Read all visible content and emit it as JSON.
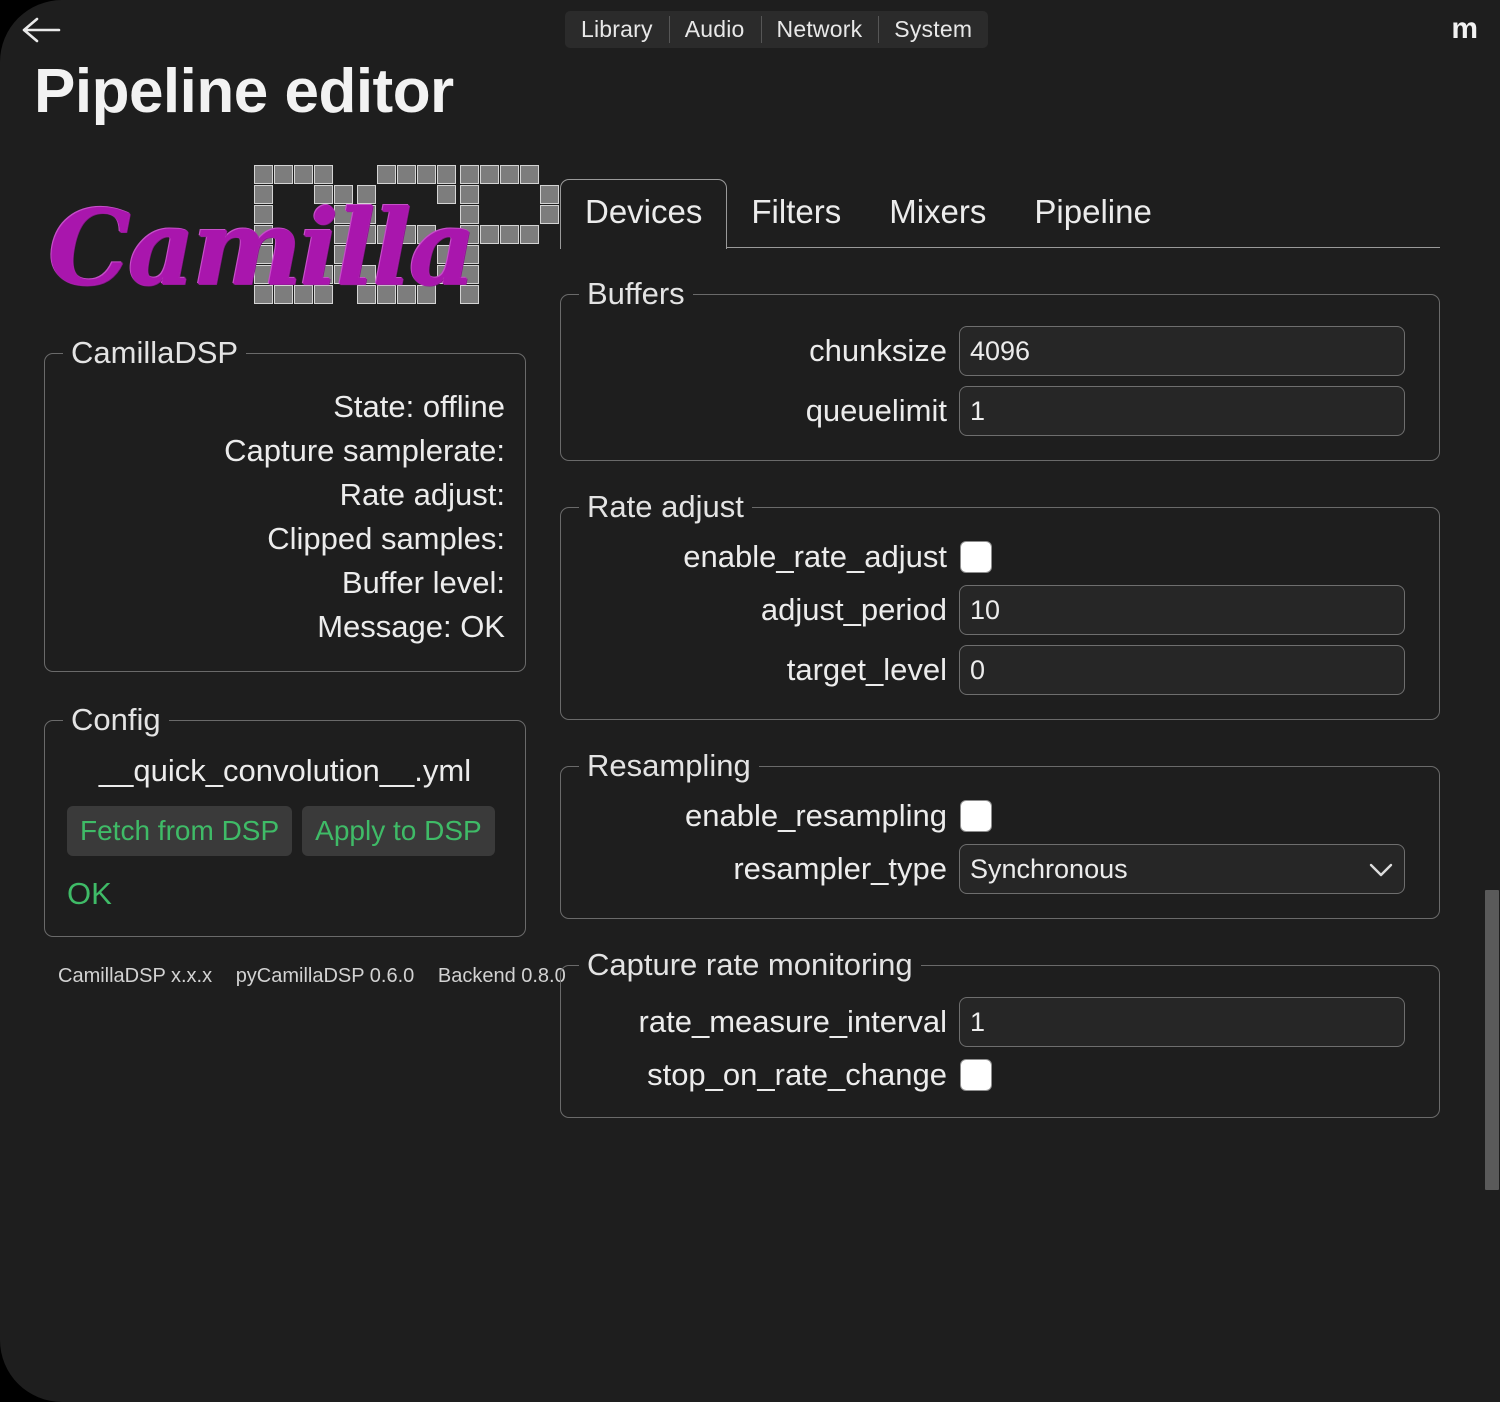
{
  "window": {
    "back_icon": "arrow-left-icon",
    "user_badge": "m",
    "title": "Pipeline editor"
  },
  "nav_tabs": [
    {
      "label": "Library"
    },
    {
      "label": "Audio"
    },
    {
      "label": "Network"
    },
    {
      "label": "System"
    }
  ],
  "logo": {
    "script_text": "Camilla",
    "block_text": "DSP",
    "script_color": "#a916ad",
    "block_color": "#7d7d7d"
  },
  "status_panel": {
    "legend": "CamillaDSP",
    "rows": [
      "State: offline",
      "Capture samplerate:",
      "Rate adjust:",
      "Clipped samples:",
      "Buffer level:",
      "Message: OK"
    ]
  },
  "config_panel": {
    "legend": "Config",
    "filename": "__quick_convolution__.yml",
    "fetch_label": "Fetch from DSP",
    "apply_label": "Apply to DSP",
    "status": "OK",
    "status_color": "#3fbb67"
  },
  "versions": {
    "camilladsp": "CamillaDSP x.x.x",
    "pycamilladsp": "pyCamillaDSP 0.6.0",
    "backend": "Backend 0.8.0"
  },
  "main_tabs": [
    {
      "label": "Devices",
      "active": true
    },
    {
      "label": "Filters",
      "active": false
    },
    {
      "label": "Mixers",
      "active": false
    },
    {
      "label": "Pipeline",
      "active": false
    }
  ],
  "sections": {
    "buffers": {
      "legend": "Buffers",
      "fields": [
        {
          "label": "chunksize",
          "value": "4096",
          "type": "text"
        },
        {
          "label": "queuelimit",
          "value": "1",
          "type": "text"
        }
      ]
    },
    "rate_adjust": {
      "legend": "Rate adjust",
      "fields": [
        {
          "label": "enable_rate_adjust",
          "value": "",
          "type": "checkbox",
          "checked": false
        },
        {
          "label": "adjust_period",
          "value": "10",
          "type": "text"
        },
        {
          "label": "target_level",
          "value": "0",
          "type": "text"
        }
      ]
    },
    "resampling": {
      "legend": "Resampling",
      "fields": [
        {
          "label": "enable_resampling",
          "value": "",
          "type": "checkbox",
          "checked": false
        },
        {
          "label": "resampler_type",
          "value": "Synchronous",
          "type": "select",
          "chevron": "chevron-down-icon"
        }
      ]
    },
    "capture_rate_monitoring": {
      "legend": "Capture rate monitoring",
      "fields": [
        {
          "label": "rate_measure_interval",
          "value": "1",
          "type": "text"
        },
        {
          "label": "stop_on_rate_change",
          "value": "",
          "type": "checkbox",
          "checked": false
        }
      ]
    }
  },
  "scrollbar": {
    "present": true
  }
}
